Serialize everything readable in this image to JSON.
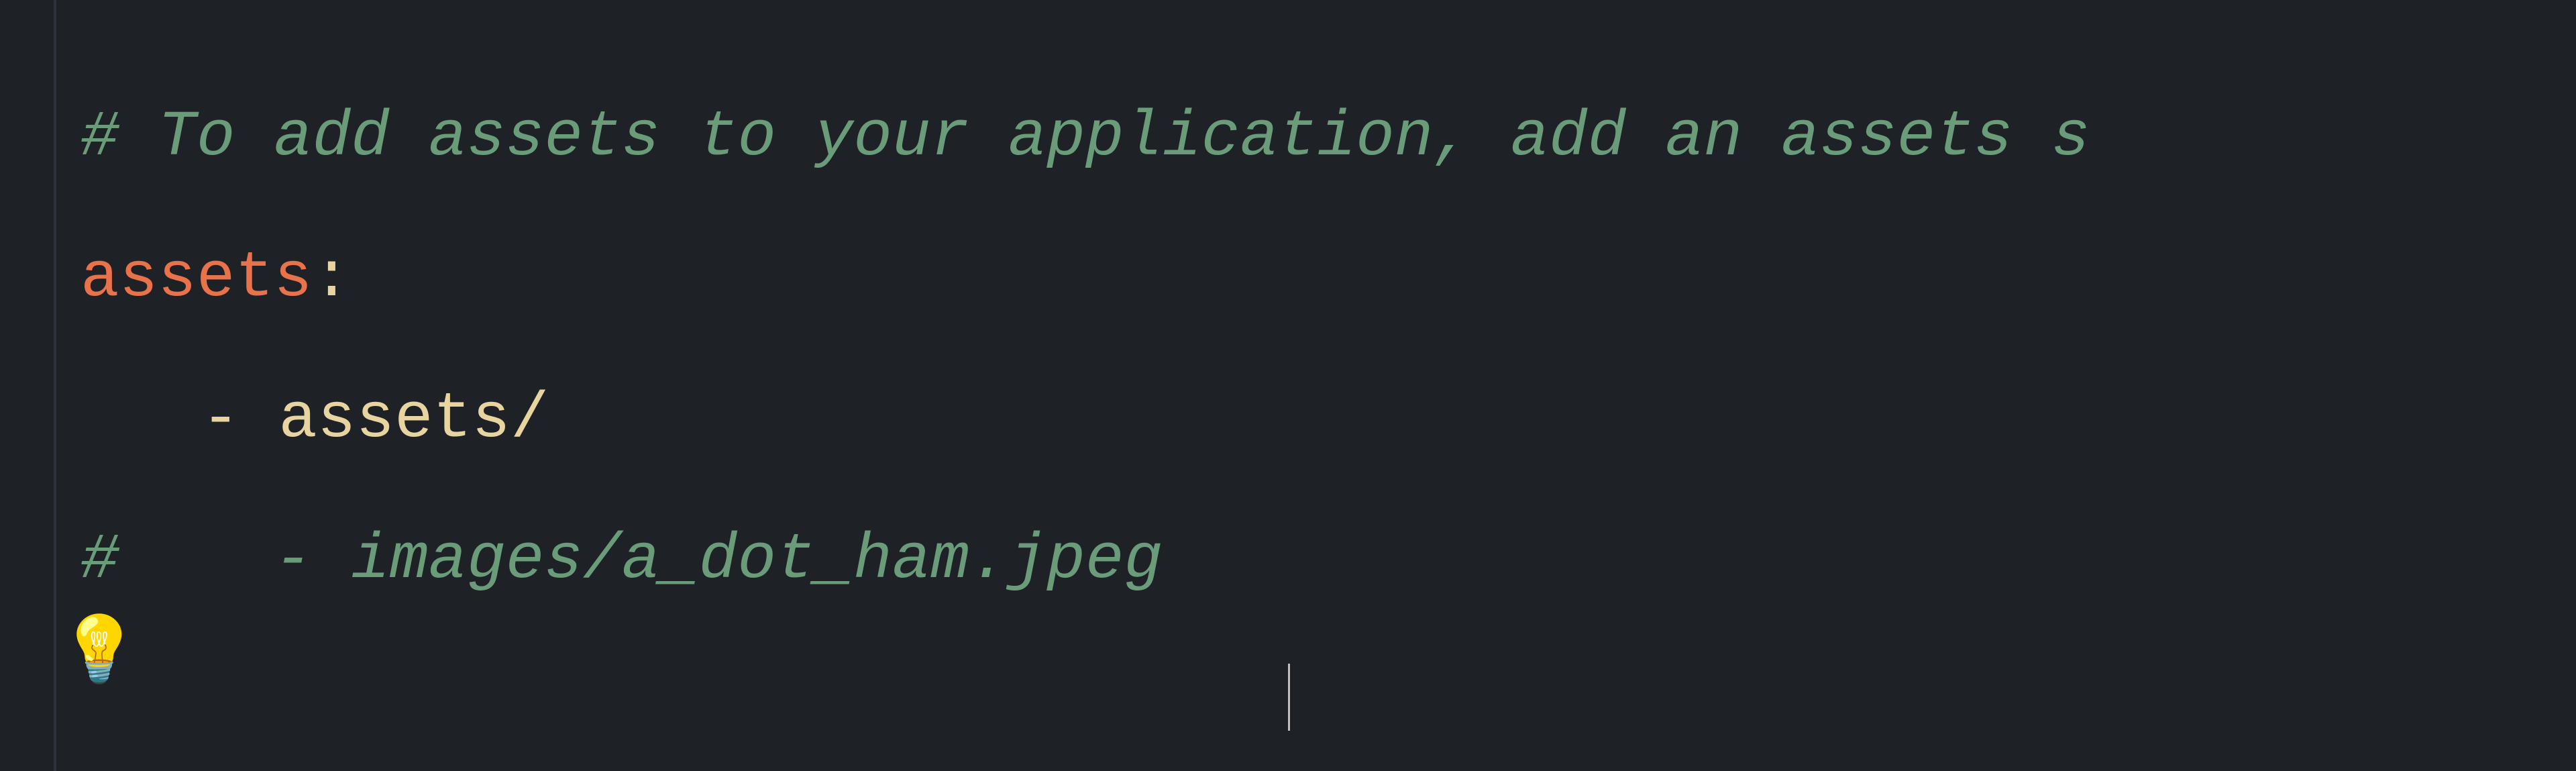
{
  "editor": {
    "background_color": "#1e2227",
    "font_size": "96px",
    "lines": [
      {
        "id": "line1",
        "type": "comment",
        "content": "# To add assets to your application, add an assets s",
        "style": "comment"
      },
      {
        "id": "line2",
        "type": "key",
        "content": "assets:",
        "key": "assets",
        "colon": ":",
        "style": "key"
      },
      {
        "id": "line3",
        "type": "value",
        "indent": true,
        "content": "- assets/",
        "style": "value"
      },
      {
        "id": "line4",
        "type": "commented-value",
        "content": "#    - images/a_dot_ham.jpeg",
        "hash": "#",
        "value": "   - images/a_dot_ham.jpeg",
        "style": "comment"
      }
    ],
    "lightbulb": "💡",
    "cursor_visible": true
  }
}
